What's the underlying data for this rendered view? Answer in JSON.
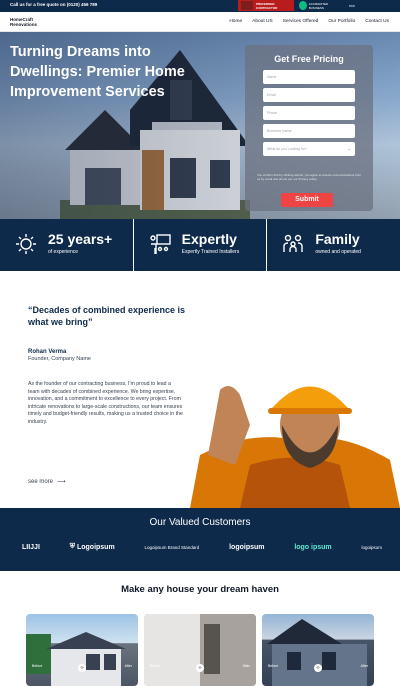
{
  "topbar": {
    "call_text": "Call us for a free quote on (0120) 456 789",
    "badges": [
      "PREFERRED CONTRACTOR",
      "ACCREDITED BUSINESS",
      "BBB"
    ]
  },
  "nav": {
    "logo_line1": "HomeCraft",
    "logo_line2": "Renovations",
    "links": [
      "Home",
      "About US",
      "Services Offered",
      "Our Portfolio",
      "Contact Us"
    ]
  },
  "hero": {
    "title": "Turning Dreams into Dwellings: Premier Home Improvement Services",
    "form": {
      "title": "Get Free Pricing",
      "fields": [
        "Name",
        "Email",
        "Phone",
        "Business Name"
      ],
      "select_placeholder": "What do you Looking for?",
      "consent": "You confirm that by clicking submit, you agree to receive communications from us by email and phone per our Privacy policy.",
      "submit": "Submit"
    }
  },
  "stats": [
    {
      "icon": "badge-icon",
      "big": "25 years+",
      "small": "of experience"
    },
    {
      "icon": "presentation-icon",
      "big": "Expertly",
      "small": "Expertly Trained Installers"
    },
    {
      "icon": "family-icon",
      "big": "Family",
      "small": "owned and operated"
    }
  ],
  "founder": {
    "quote": "“Decades of combined experience is what we bring”",
    "name": "Rohan Verma",
    "role": "Founder, Company Name",
    "about": "As the founder of our contracting business, I'm proud to lead a team with decades of combined experience. We bring expertise, innovation, and a commitment to excellence to every project. From intricate renovations to large-scale constructions, our team ensures timely and budget-friendly results, making us a trusted choice in the industry.",
    "see_more": "see more"
  },
  "customers": {
    "title": "Our Valued Customers",
    "logos": [
      "LIIJJI",
      "Logoipsum",
      "Logoipsum Brand Standard",
      "logoipsum",
      "logo ipsum",
      "logoipsum"
    ]
  },
  "gallery": {
    "title": "Make any house your dream haven",
    "labels": [
      "Before",
      "After"
    ]
  },
  "colors": {
    "navy": "#0d2a4a",
    "accent_red": "#ef4444"
  }
}
